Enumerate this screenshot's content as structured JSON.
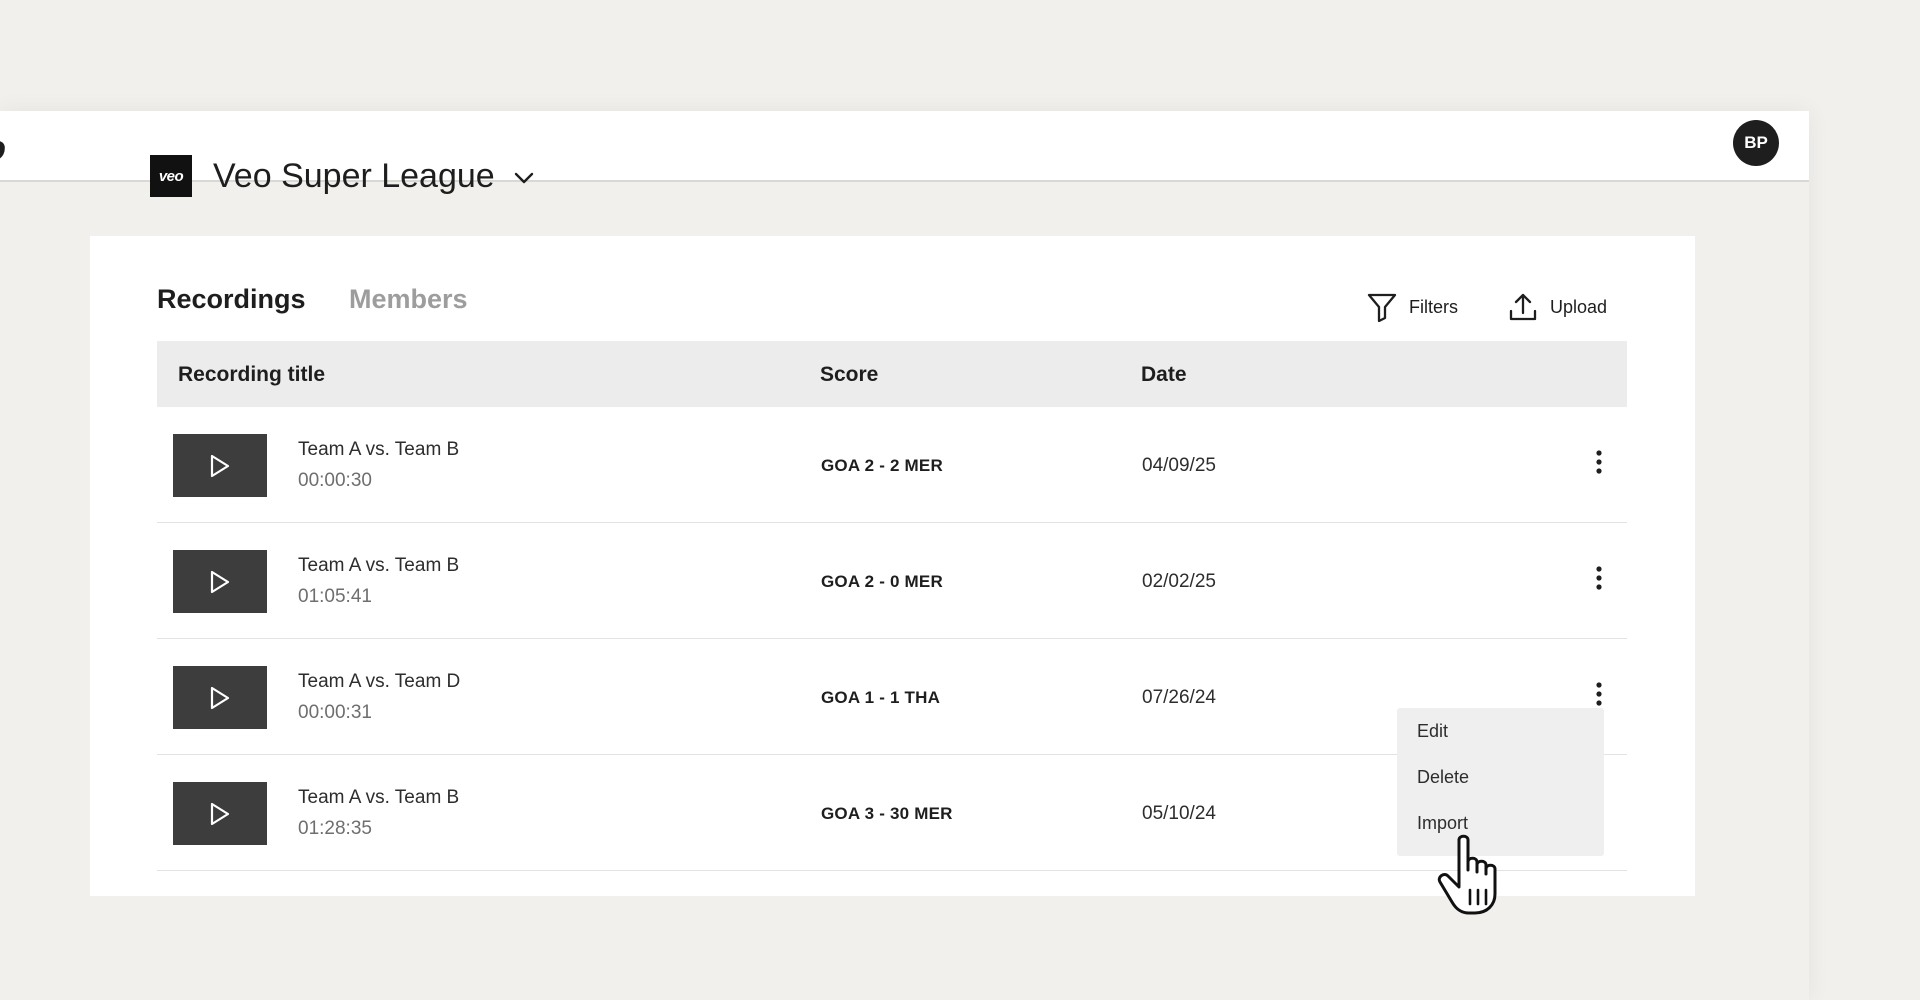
{
  "app": {
    "logo_fragment": "o",
    "user_initials": "BP"
  },
  "league": {
    "logo_text": "veo",
    "name": "Veo Super League",
    "dropdown_icon": "chevron-down-icon"
  },
  "tabs": [
    {
      "label": "Recordings",
      "active": true
    },
    {
      "label": "Members",
      "active": false
    }
  ],
  "toolbar": {
    "filters_label": "Filters",
    "filters_icon": "filter-icon",
    "upload_label": "Upload",
    "upload_icon": "upload-icon"
  },
  "table": {
    "headers": {
      "title": "Recording title",
      "score": "Score",
      "date": "Date"
    },
    "rows": [
      {
        "title": "Team A vs. Team B",
        "duration": "00:00:30",
        "score": "GOA 2 - 2 MER",
        "date": "04/09/25"
      },
      {
        "title": "Team A vs. Team B",
        "duration": "01:05:41",
        "score": "GOA 2 - 0 MER",
        "date": "02/02/25"
      },
      {
        "title": "Team A vs. Team D",
        "duration": "00:00:31",
        "score": "GOA 1 - 1 THA",
        "date": "07/26/24"
      },
      {
        "title": "Team A vs. Team B",
        "duration": "01:28:35",
        "score": "GOA 3 - 30 MER",
        "date": "05/10/24"
      }
    ]
  },
  "context_menu": {
    "items": [
      "Edit",
      "Delete",
      "Import"
    ]
  },
  "colors": {
    "background": "#f1f0ed",
    "panel": "#ffffff",
    "header_row": "#ececec",
    "thumbnail": "#3d3d3d",
    "menu": "#efefef",
    "text": "#1e1e1e",
    "muted": "#9d9d9d"
  }
}
